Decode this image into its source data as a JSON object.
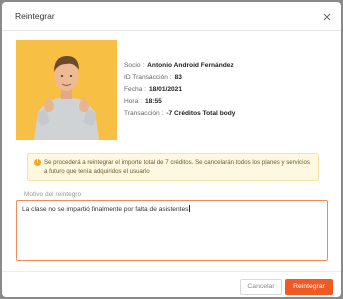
{
  "modal": {
    "title": "Reintegrar"
  },
  "details": {
    "socio_label": "Socio :",
    "socio_value": "Antonio Android Fernández",
    "id_label": "ID Transacción :",
    "id_value": "83",
    "fecha_label": "Fecha :",
    "fecha_value": "18/01/2021",
    "hora_label": "Hora :",
    "hora_value": "18:55",
    "transaccion_label": "Transacción :",
    "transaccion_value": "-7 Créditos Total body"
  },
  "alert": {
    "icon": "exclamation-icon",
    "text": "Se procederá a reintegrar el importe total de 7 créditos. Se cancelarán todos los planes y servicios a futuro que tenía adquiridos el usuario"
  },
  "reason": {
    "label": "Motivo del reintegro",
    "value": "La clase no se impartió finalmente por falta de asistentes"
  },
  "footer": {
    "cancel_label": "Cancelar",
    "confirm_label": "Reintegrar"
  },
  "colors": {
    "accent": "#f15a24",
    "photo_background": "#f7c045",
    "alert_background": "#fff8e1"
  }
}
